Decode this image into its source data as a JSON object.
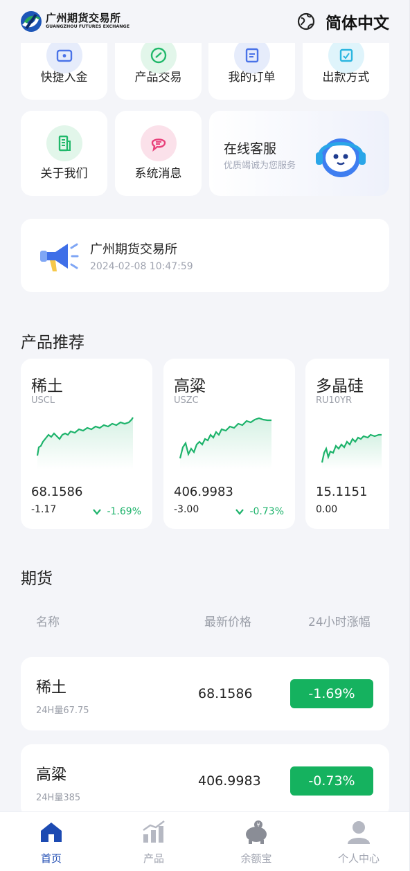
{
  "header": {
    "logo_cn": "广州期货交易所",
    "logo_en": "GUANGZHOU FUTURES EXCHANGE",
    "language": "简体中文"
  },
  "quick_actions": [
    {
      "label": "快捷入金",
      "icon": "wallet-icon",
      "color": "#4a73e8"
    },
    {
      "label": "产品交易",
      "icon": "trade-icon",
      "color": "#20b86a"
    },
    {
      "label": "我的订单",
      "icon": "order-icon",
      "color": "#4a73e8"
    },
    {
      "label": "出款方式",
      "icon": "withdraw-icon",
      "color": "#2bb6e0"
    },
    {
      "label": "关于我们",
      "icon": "building-icon",
      "color": "#20b86a"
    },
    {
      "label": "系统消息",
      "icon": "message-icon",
      "color": "#e8407a"
    }
  ],
  "service": {
    "title": "在线客服",
    "subtitle": "优质竭诚为您服务"
  },
  "notice": {
    "title": "广州期货交易所",
    "time": "2024-02-08 10:47:59"
  },
  "recommend": {
    "title": "产品推荐",
    "items": [
      {
        "name": "稀土",
        "code": "USCL",
        "price": "68.1586",
        "delta": "-1.17",
        "pct": "-1.69%"
      },
      {
        "name": "高粱",
        "code": "USZC",
        "price": "406.9983",
        "delta": "-3.00",
        "pct": "-0.73%"
      },
      {
        "name": "多晶硅",
        "code": "RU10YR",
        "price": "15.1151",
        "delta": "0.00",
        "pct": ""
      }
    ]
  },
  "futures": {
    "title": "期货",
    "columns": [
      "名称",
      "最新价格",
      "24小时涨幅"
    ],
    "rows": [
      {
        "name": "稀土",
        "volume": "24H量67.75",
        "price": "68.1586",
        "pct": "-1.69%"
      },
      {
        "name": "高粱",
        "volume": "24H量385",
        "price": "406.9983",
        "pct": "-0.73%"
      }
    ]
  },
  "tabbar": {
    "items": [
      {
        "label": "首页",
        "icon": "home-icon",
        "active": true
      },
      {
        "label": "产品",
        "icon": "chart-icon",
        "active": false
      },
      {
        "label": "余额宝",
        "icon": "piggy-bank-icon",
        "active": false
      },
      {
        "label": "个人中心",
        "icon": "user-icon",
        "active": false
      }
    ]
  },
  "colors": {
    "accent": "#1c4ab2",
    "up_green": "#15b25f",
    "background": "#f4f5f9"
  }
}
